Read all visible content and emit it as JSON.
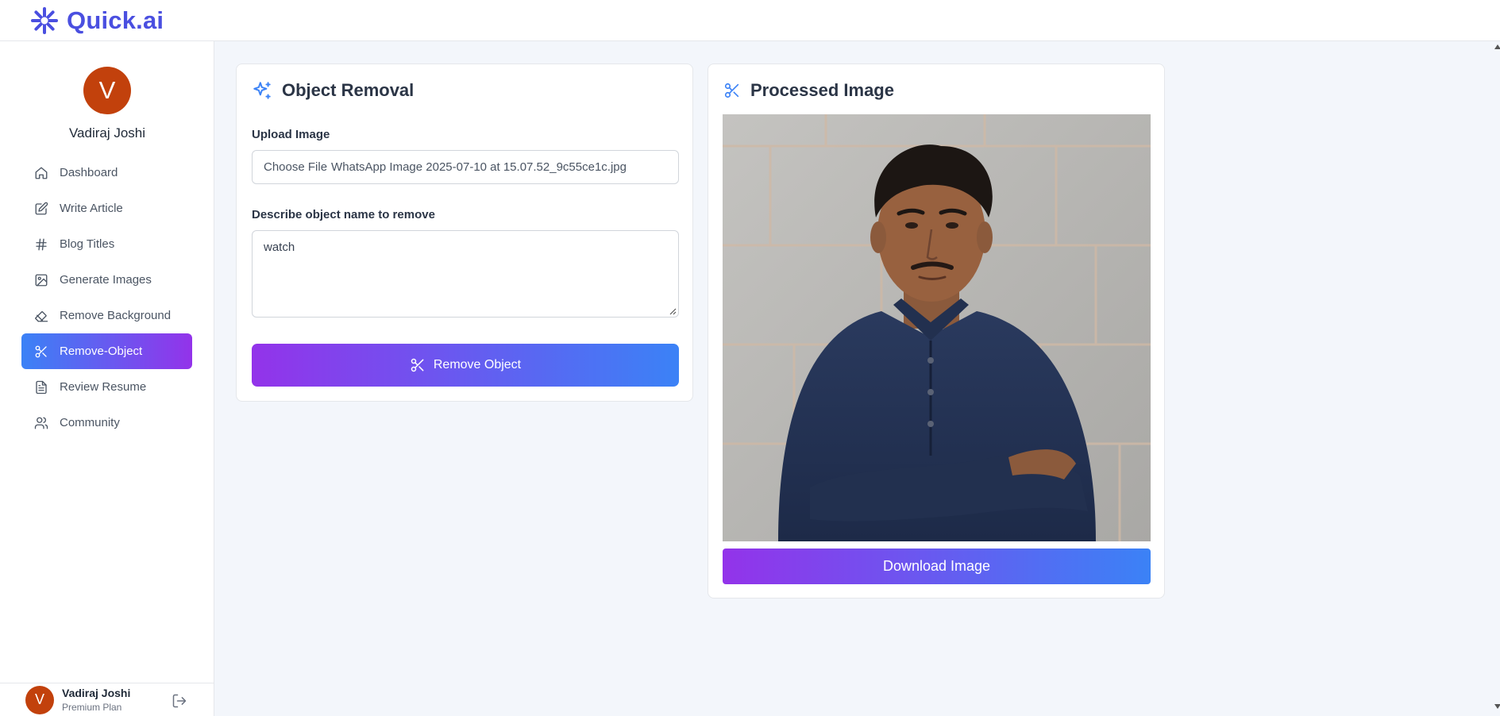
{
  "app": {
    "name": "Quick.ai",
    "brand_color": "#4a4fe0"
  },
  "profile": {
    "initial": "V",
    "name": "Vadiraj Joshi",
    "avatar_color": "#c2410c"
  },
  "sidebar": {
    "items": [
      {
        "label": "Dashboard",
        "icon": "home-icon",
        "active": false
      },
      {
        "label": "Write Article",
        "icon": "edit-icon",
        "active": false
      },
      {
        "label": "Blog Titles",
        "icon": "hash-icon",
        "active": false
      },
      {
        "label": "Generate Images",
        "icon": "image-icon",
        "active": false
      },
      {
        "label": "Remove Background",
        "icon": "eraser-icon",
        "active": false
      },
      {
        "label": "Remove-Object",
        "icon": "scissors-icon",
        "active": true
      },
      {
        "label": "Review Resume",
        "icon": "file-text-icon",
        "active": false
      },
      {
        "label": "Community",
        "icon": "users-icon",
        "active": false
      }
    ]
  },
  "footer": {
    "initial": "V",
    "name": "Vadiraj Joshi",
    "plan": "Premium Plan"
  },
  "object_removal": {
    "title": "Object Removal",
    "upload_label": "Upload Image",
    "file_button": "Choose File",
    "file_name": "WhatsApp Image 2025-07-10 at 15.07.52_9c55ce1c.jpg",
    "describe_label": "Describe object name to remove",
    "describe_value": "watch",
    "submit_label": "Remove Object",
    "accent": "#3b82f6"
  },
  "processed": {
    "title": "Processed Image",
    "download_label": "Download Image"
  }
}
